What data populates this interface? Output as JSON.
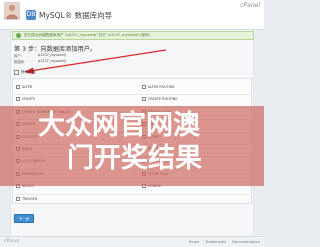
{
  "header": {
    "brand": "cPanel",
    "page_title": "MySQL® 数据库向导",
    "db_icon_label": "DB",
    "avatar_icon": "user-avatar-icon"
  },
  "success": {
    "icon": "check-icon",
    "message": "您已成功创建数据库用户 \"p1237_myuxknji\" 并已 \"p1237_myuxknji\"(密码)"
  },
  "step": {
    "title": "第 3 步：向数据库添加用户。",
    "user_label": "用户：",
    "user_value": "p1237_myuxknji",
    "db_label": "数据库：",
    "db_value": "p1237_myuxknji"
  },
  "privileges": {
    "all_label": "所有权限",
    "left": [
      "ALTER",
      "CREATE",
      "CREATE TEMPORARY TABLES",
      "DELETE",
      "EXECUTE",
      "INDEX",
      "LOCK TABLES",
      "REFERENCES",
      "SELECT",
      "TRIGGER"
    ],
    "right": [
      "ALTER ROUTINE",
      "CREATE ROUTINE",
      "CREATE VIEW",
      "DROP",
      "EVENT",
      "INSERT",
      "REFERENCES",
      "SHOW VIEW",
      "UPDATE"
    ]
  },
  "actions": {
    "next_label": "下一步"
  },
  "footer": {
    "logo": "cPanel",
    "links": [
      "Home",
      "Trademarks",
      "Documentation"
    ]
  },
  "overlay": {
    "line1": "大众网官网澳",
    "line2": "门开奖结果"
  },
  "colors": {
    "accent": "#3f8fd0",
    "success_bg": "#e6f2d9",
    "overlay": "#cd645a",
    "arrow": "#d9262a"
  }
}
